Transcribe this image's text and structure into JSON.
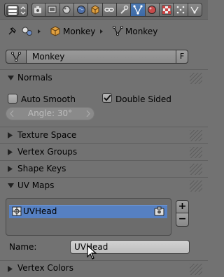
{
  "toolbar": {
    "editor_icon": "properties-editor-icon",
    "context_tabs": [
      {
        "icon": "render-icon",
        "active": false
      },
      {
        "icon": "render-layers-icon",
        "active": false
      },
      {
        "icon": "scene-icon",
        "active": false
      },
      {
        "icon": "world-icon",
        "active": false
      },
      {
        "icon": "object-icon",
        "active": false
      },
      {
        "icon": "constraints-icon",
        "active": false
      },
      {
        "icon": "modifiers-icon",
        "active": false
      },
      {
        "icon": "mesh-data-icon",
        "active": true
      },
      {
        "icon": "material-icon",
        "active": false
      },
      {
        "icon": "texture-icon",
        "active": false
      },
      {
        "icon": "particles-icon",
        "active": false
      },
      {
        "icon": "physics-icon",
        "active": false
      }
    ],
    "accent_color": "#4a76b3"
  },
  "breadcrumb": {
    "items": [
      "Monkey",
      "Monkey"
    ]
  },
  "datablock": {
    "name": "Monkey",
    "fake_user_label": "F"
  },
  "panels": {
    "normals": {
      "title": "Normals",
      "expanded": true,
      "auto_smooth": {
        "label": "Auto Smooth",
        "checked": false
      },
      "double_sided": {
        "label": "Double Sided",
        "checked": true
      },
      "angle": "Angle: 30°"
    },
    "texture_space": {
      "title": "Texture Space",
      "expanded": false
    },
    "vertex_groups": {
      "title": "Vertex Groups",
      "expanded": false
    },
    "shape_keys": {
      "title": "Shape Keys",
      "expanded": false
    },
    "uv_maps": {
      "title": "UV Maps",
      "expanded": true,
      "items": [
        {
          "name": "UVHead",
          "selected": true
        }
      ],
      "add_label": "+",
      "remove_label": "−",
      "name_label": "Name:",
      "name_value": "UVHead"
    },
    "vertex_colors": {
      "title": "Vertex Colors",
      "expanded": false
    }
  }
}
